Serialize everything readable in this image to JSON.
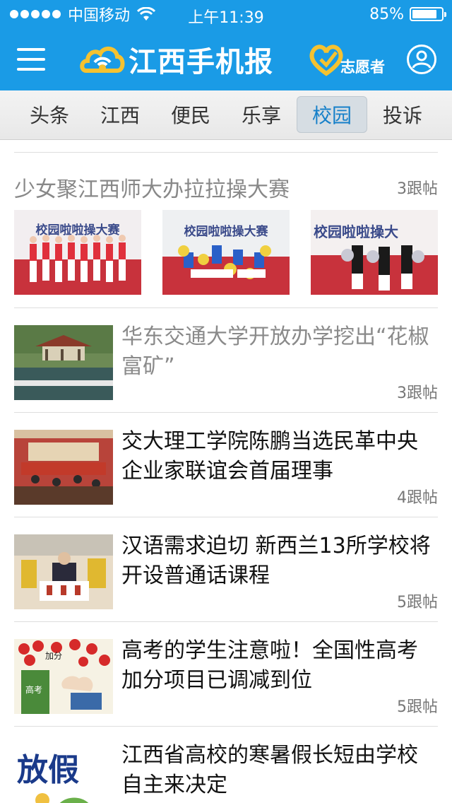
{
  "status_bar": {
    "carrier": "中国移动",
    "time": "上午11:39",
    "battery": "85%",
    "battery_level": 0.85
  },
  "app_bar": {
    "app_title": "江西手机报",
    "volunteer_label": "志愿者"
  },
  "tabs": [
    {
      "label": "头条",
      "active": false
    },
    {
      "label": "江西",
      "active": false
    },
    {
      "label": "便民",
      "active": false
    },
    {
      "label": "乐享",
      "active": false
    },
    {
      "label": "校园",
      "active": true
    },
    {
      "label": "投诉",
      "active": false
    }
  ],
  "gallery": {
    "title": "少女聚江西师大办拉拉操大赛",
    "count": "3跟帖",
    "images": [
      {
        "banner": "校园啦啦操大赛"
      },
      {
        "banner": "校园啦啦操大赛"
      },
      {
        "banner": "校园啦啦操大"
      }
    ]
  },
  "articles": [
    {
      "title": "华东交通大学开放办学挖出“花椒富矿”",
      "count": "3跟帖",
      "read": true
    },
    {
      "title": "交大理工学院陈鹏当选民革中央企业家联谊会首届理事",
      "count": "4跟帖",
      "read": false
    },
    {
      "title": "汉语需求迫切 新西兰13所学校将开设普通话课程",
      "count": "5跟帖",
      "read": false
    },
    {
      "title": "高考的学生注意啦！全国性高考加分项目已调减到位",
      "count": "5跟帖",
      "read": false
    },
    {
      "title": "江西省高校的寒暑假长短由学校自主来决定",
      "count": "",
      "read": false
    }
  ],
  "thumb_text": {
    "exam_score": "加分",
    "exam_label": "高考",
    "holiday": "放假"
  },
  "colors": {
    "brand_blue": "#1a9be6",
    "active_tab_text": "#1680c9",
    "logo_yellow": "#f5c230"
  }
}
